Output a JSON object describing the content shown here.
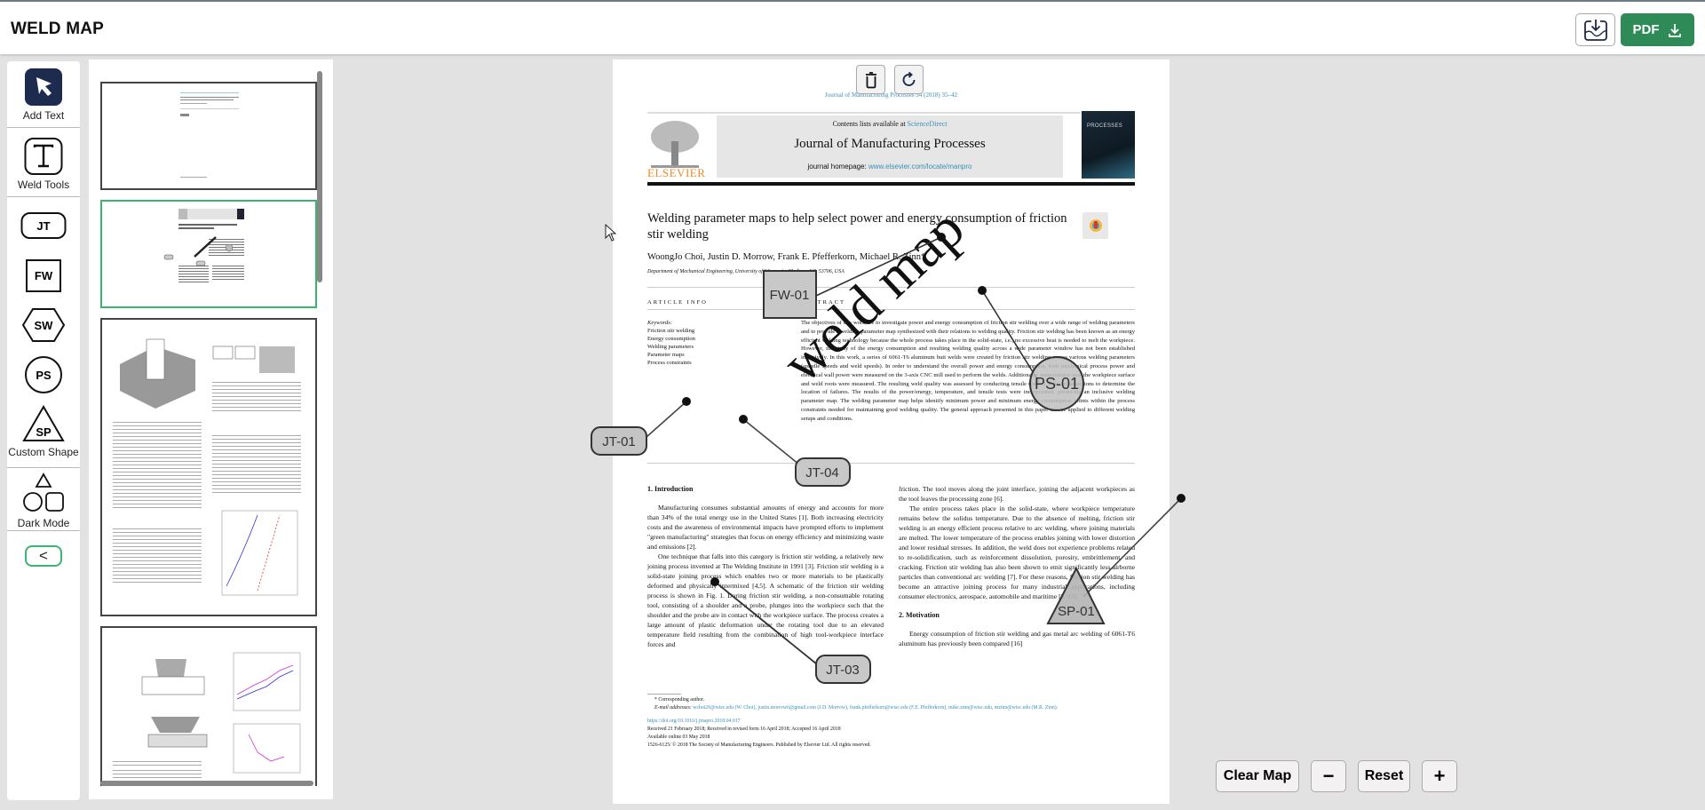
{
  "app": {
    "title": "WELD MAP"
  },
  "header": {
    "image_download_icon": "image-download-icon",
    "pdf_button_label": "PDF",
    "pdf_icon": "download-icon"
  },
  "toolbox": {
    "items": [
      {
        "id": "select",
        "label": "Add Text",
        "icon": "select-arrow-icon"
      },
      {
        "id": "text",
        "label": "Weld Tools",
        "icon": "text-t-icon"
      },
      {
        "id": "jt",
        "label": "JT",
        "icon": "jt-rounded-rect-icon"
      },
      {
        "id": "fw",
        "label": "FW",
        "icon": "fw-square-icon"
      },
      {
        "id": "sw",
        "label": "SW",
        "icon": "sw-hexagon-icon"
      },
      {
        "id": "ps",
        "label": "PS",
        "icon": "ps-circle-icon"
      },
      {
        "id": "sp",
        "label": "SP",
        "icon": "sp-triangle-icon"
      },
      {
        "id": "custom",
        "label": "Custom Shape",
        "icon": "shapes-icon"
      },
      {
        "id": "dark",
        "label": "Dark Mode"
      }
    ],
    "sp_caption": "Custom Shape",
    "shapes_caption": "Dark Mode",
    "collapse_label": "<"
  },
  "thumbnails": {
    "pages": [
      {
        "page": 1,
        "active": false
      },
      {
        "page": 2,
        "active": true
      },
      {
        "page": 3,
        "active": false
      },
      {
        "page": 4,
        "active": false
      }
    ]
  },
  "page_tools": {
    "delete_icon": "trash-icon",
    "rotate_icon": "rotate-icon"
  },
  "document": {
    "journal_ref": "Journal of Manufacturing Processes 34 (2018) 35–42",
    "contents_prefix": "Contents lists available at ",
    "contents_link": "ScienceDirect",
    "journal_title": "Journal of Manufacturing Processes",
    "homepage_prefix": "journal homepage: ",
    "homepage_link": "www.elsevier.com/locate/manpro",
    "publisher": "ELSEVIER",
    "cover_text": "PROCESSES",
    "check_updates": "Check for updates",
    "title": "Welding parameter maps to help select power and energy consumption of friction stir welding",
    "authors": "WoongJo Choi, Justin D. Morrow, Frank E. Pfefferkorn, Michael R. Zinn*",
    "affiliation": "Department of Mechanical Engineering, University of Wisconsin, Madison, WI, 53706, USA",
    "article_info_label": "ARTICLE INFO",
    "abstract_label": "ABSTRACT",
    "keywords_label": "Keywords:",
    "keywords": [
      "Friction stir welding",
      "Energy consumption",
      "Welding parameters",
      "Parameter maps",
      "Process constraints"
    ],
    "abstract": "The objectives of this work are to investigate power and energy consumption of friction stir welding over a wide range of welding parameters and to provide a welding parameter map synthesized with their relations to welding quality. Friction stir welding has been known as an energy efficient welding technology because the whole process takes place in the solid-state, i.e., no excessive heat is needed to melt the workpiece. However, the study of the energy consumption and resulting welding quality across a wide parameter window has not been established inclusively. In this work, a series of 6061-T6 aluminum butt welds were created by friction stir welding across various welding parameters (spindle speeds and weld speeds). In order to understand the overall power and energy consumption, both mechanical process power and electrical wall power were measured on the 3-axis CNC mill used to perform the welds. Additionally, temperatures near the workpiece surface and weld roots were measured. The resulting weld quality was assessed by conducting tensile tests of weld cross-sections to determine the location of failures. The results of the power/energy, temperature, and tensile tests were incorporated, producing an inclusive welding parameter map. The welding parameter map helps identify minimum power and minimum energy consumption points within the process constraints needed for maintaining good welding quality. The general approach presented in this paper can be applied to different welding setups and conditions.",
    "intro_heading": "1. Introduction",
    "intro_p1": "Manufacturing consumes substantial amounts of energy and accounts for more than 34% of the total energy use in the United States [1]. Both increasing electricity costs and the awareness of environmental impacts have prompted efforts to implement \"green manufacturing\" strategies that focus on energy efficiency and minimizing waste and emissions [2].",
    "intro_p2": "One technique that falls into this category is friction stir welding, a relatively new joining process invented at The Welding Institute in 1991 [3]. Friction stir welding is a solid-state joining process which enables two or more materials to be plastically deformed and physically intermixed [4,5]. A schematic of the friction stir welding process is shown in Fig. 1. During friction stir welding, a non-consumable rotating tool, consisting of a shoulder and a probe, plunges into the workpiece such that the shoulder and the probe are in contact with the workpiece surface. The process creates a large amount of plastic deformation under the rotating tool due to an elevated temperature field resulting from the combination of high tool-workpiece interface forces and",
    "right_p1": "friction. The tool moves along the joint interface, joining the adjacent workpieces as the tool leaves the processing zone [6].",
    "right_p2": "The entire process takes place in the solid-state, where workpiece temperature remains below the solidus temperature. Due to the absence of melting, friction stir welding is an energy efficient process relative to arc welding, where joining materials are melted. The lower temperature of the process enables joining with lower distortion and lower residual stresses. In addition, the weld does not experience problems related to re-solidification, such as reinforcement dissolution, porosity, embrittlement, and cracking. Friction stir welding has also been shown to emit significantly less airborne particles than conventional arc welding [7]. For these reasons, friction stir welding has become an attractive joining process for many industrial applications, including consumer electronics, aerospace, automobile and maritime [8–15].",
    "motivation_heading": "2. Motivation",
    "motivation_p1": "Energy consumption of friction stir welding and gas metal arc welding of 6061-T6 aluminum has previously been compared [16]",
    "fn_corresponding": "* Corresponding author.",
    "fn_emails_label": "E-mail addresses: ",
    "fn_emails": "wchoi26@wisc.edu (W. Choi), justin.morrow6@gmail.com (J.D. Morrow), frank.pfefferkorn@wisc.edu (F.E. Pfefferkorn), mike.zinn@wisc.edu, mzinn@wisc.edu (M.R. Zinn).",
    "doi": "https://doi.org/10.1016/j.jmapro.2018.04.017",
    "received": "Received 21 February 2018; Received in revised form 16 April 2018; Accepted 16 April 2018",
    "available": "Available online 03 May 2018",
    "copyright": "1526-6125/ © 2018 The Society of Manufacturing Engineers. Published by Elsevier Ltd. All rights reserved."
  },
  "annotations": {
    "watermark": "weld map",
    "markers": [
      {
        "id": "FW-01",
        "shape": "square"
      },
      {
        "id": "PS-01",
        "shape": "circle"
      },
      {
        "id": "JT-01",
        "shape": "rounded-rect"
      },
      {
        "id": "JT-04",
        "shape": "rounded-rect"
      },
      {
        "id": "JT-03",
        "shape": "rounded-rect"
      },
      {
        "id": "SP-01",
        "shape": "triangle"
      }
    ]
  },
  "zoom_controls": {
    "clear_label": "Clear Map",
    "zoom_out_label": "−",
    "reset_label": "Reset",
    "zoom_in_label": "+"
  }
}
